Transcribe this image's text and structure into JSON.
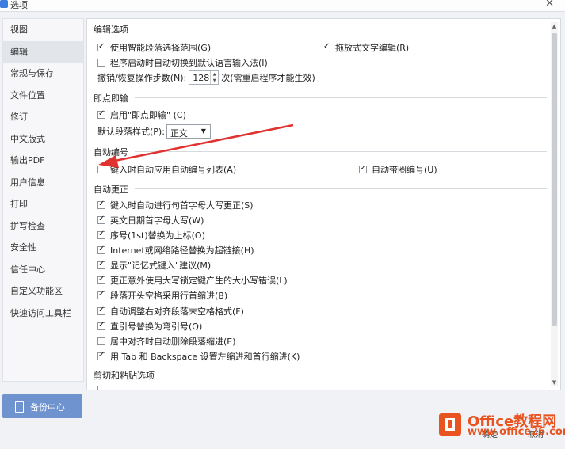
{
  "window": {
    "title": "选项"
  },
  "sidebar": {
    "items": [
      {
        "label": "视图"
      },
      {
        "label": "编辑",
        "active": true
      },
      {
        "label": "常规与保存"
      },
      {
        "label": "文件位置"
      },
      {
        "label": "修订"
      },
      {
        "label": "中文版式"
      },
      {
        "label": "输出PDF"
      },
      {
        "label": "用户信息"
      },
      {
        "label": "打印"
      },
      {
        "label": "拼写检查"
      },
      {
        "label": "安全性"
      },
      {
        "label": "信任中心"
      },
      {
        "label": "自定义功能区"
      },
      {
        "label": "快速访问工具栏"
      }
    ],
    "backup_label": "备份中心"
  },
  "edit_options": {
    "title": "编辑选项",
    "smart_para_select": {
      "label": "使用智能段落选择范围(G)",
      "checked": true
    },
    "drag_text_edit": {
      "label": "拖放式文字编辑(R)",
      "checked": true
    },
    "auto_switch_ime": {
      "label": "程序启动时自动切换到默认语言输入法(I)",
      "checked": false
    },
    "undo_steps_label": "撤销/恢复操作步数(N):",
    "undo_steps_value": "128",
    "undo_steps_note": "次(需重启程序才能生效)"
  },
  "click_and_type": {
    "title": "即点即输",
    "enable": {
      "label": "启用\"即点即输\" (C)",
      "checked": true
    },
    "default_style_label": "默认段落样式(P):",
    "default_style_value": "正文"
  },
  "auto_numbering": {
    "title": "自动编号",
    "auto_list": {
      "label": "键入时自动应用自动编号列表(A)",
      "checked": false
    },
    "auto_circle": {
      "label": "自动带圈编号(U)",
      "checked": true
    }
  },
  "auto_correct": {
    "title": "自动更正",
    "items": [
      {
        "label": "键入时自动进行句首字母大写更正(S)",
        "checked": true
      },
      {
        "label": "英文日期首字母大写(W)",
        "checked": true
      },
      {
        "label": "序号(1st)替换为上标(O)",
        "checked": true
      },
      {
        "label": "Internet或网络路径替换为超链接(H)",
        "checked": true
      },
      {
        "label": "显示\"记忆式键入\"建议(M)",
        "checked": true
      },
      {
        "label": "更正意外使用大写锁定键产生的大小写错误(L)",
        "checked": true
      },
      {
        "label": "段落开头空格采用行首缩进(B)",
        "checked": true
      },
      {
        "label": "自动调整右对齐段落末空格格式(F)",
        "checked": true
      },
      {
        "label": "直引号替换为弯引号(Q)",
        "checked": true
      },
      {
        "label": "居中对齐时自动删除段落缩进(E)",
        "checked": false
      },
      {
        "label": "用 Tab 和 Backspace 设置左缩进和首行缩进(K)",
        "checked": true
      }
    ]
  },
  "clipboard": {
    "title": "剪切和粘贴选项"
  },
  "footer": {
    "ok_label": "确定",
    "cancel_label": "取消"
  },
  "watermark": {
    "name": "Office教程网",
    "url": "www.office26.com"
  },
  "colors": {
    "accent": "#6f93cf",
    "arrow": "#e0322e",
    "watermark": "#e9531f"
  }
}
